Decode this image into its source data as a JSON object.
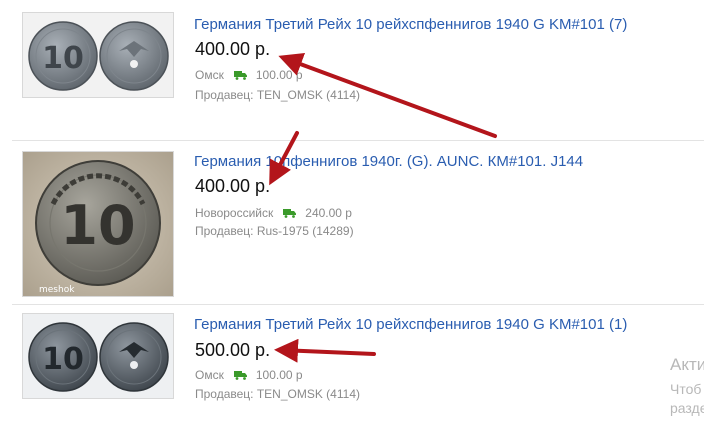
{
  "listings": [
    {
      "title": "Германия Третий Рейх 10 рейхспфеннигов 1940 G KM#101 (7)",
      "price": "400.00 р.",
      "city": "Омск",
      "shipping": "100.00 р",
      "seller": "Продавец: TEN_OMSK (4114)",
      "image": "two-zinc-coins"
    },
    {
      "title": "Германия 10пфеннигов 1940г. (G). AUNC. КМ#101. J144",
      "price": "400.00 р.",
      "city": "Новороссийск",
      "shipping": "240.00 р",
      "seller": "Продавец: Rus-1975 (14289)",
      "image": "single-coin",
      "watermark": "meshok"
    },
    {
      "title": "Германия Третий Рейх 10 рейхспфеннигов 1940 G KM#101 (1)",
      "price": "500.00 р.",
      "city": "Омск",
      "shipping": "100.00 р",
      "seller": "Продавец: TEN_OMSK (4114)",
      "image": "two-zinc-coins"
    }
  ],
  "side_text": {
    "line1": "Акти",
    "line2": "Чтоб",
    "line3": "разде"
  },
  "colors": {
    "title_link": "#2a5db0",
    "truck_icon": "#3a9a2a",
    "annotation_arrow": "#b3151b"
  }
}
